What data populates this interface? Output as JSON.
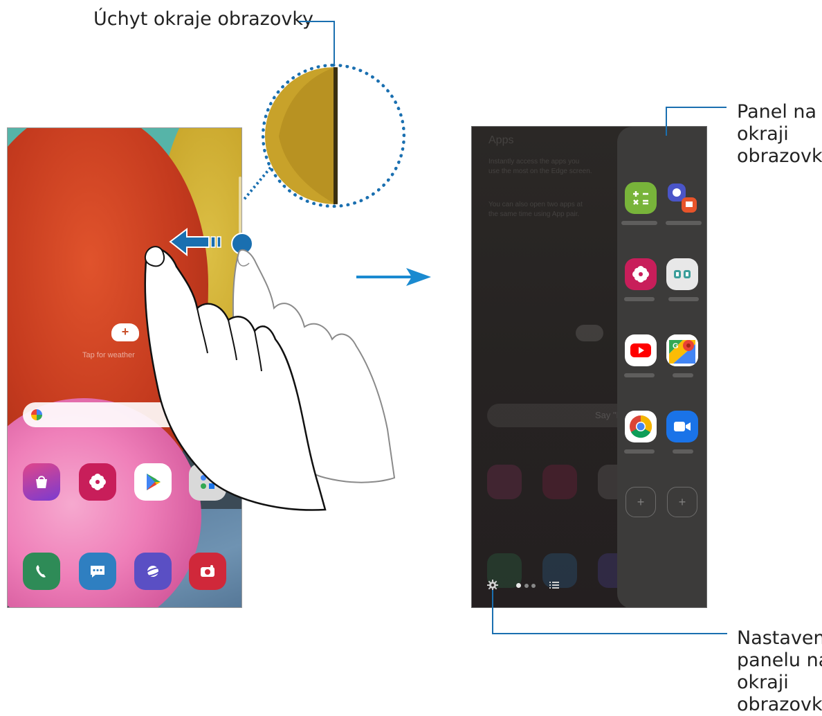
{
  "callouts": {
    "edge_handle": "Úchyt okraje obrazovky",
    "edge_panel_lines": [
      "Panel na",
      "okraji",
      "obrazovky"
    ],
    "edge_settings_lines": [
      "Nastavení",
      "panelu na",
      "okraji",
      "obrazovky"
    ]
  },
  "left_phone": {
    "weather_text": "Tap for weather",
    "dock_apps": [
      {
        "name": "Galaxy Store",
        "icon": "shopping-bag-icon",
        "color": "#c03a7a"
      },
      {
        "name": "Gallery",
        "icon": "flower-icon",
        "color": "#c81e5a"
      },
      {
        "name": "Play Store",
        "icon": "play-store-icon",
        "color": "#ffffff"
      },
      {
        "name": "Google",
        "icon": "folder-icon",
        "color": "#d9d9d9"
      }
    ],
    "bottom_apps": [
      {
        "name": "Phone",
        "icon": "phone-icon",
        "color": "#2e8b57"
      },
      {
        "name": "Messages",
        "icon": "message-icon",
        "color": "#2f7fc1"
      },
      {
        "name": "Internet",
        "icon": "planet-icon",
        "color": "#5a4fc4"
      },
      {
        "name": "Camera",
        "icon": "camera-icon",
        "color": "#d0283a"
      }
    ]
  },
  "right_phone": {
    "apps_title": "Apps",
    "apps_description": "Instantly access the apps you use the most on the Edge screen.",
    "apps_description_2": "You can also open two apps at the same time using App pair.",
    "search_text": "Say \"Hi",
    "edge_apps": [
      {
        "name": "Calculator",
        "icon": "calculator-icon",
        "color": "#78b43a"
      },
      {
        "name": "Internet Samsung Notes",
        "icon": "app-pair-icon",
        "color": "#4a55c8"
      },
      {
        "name": "Gallery",
        "icon": "flower-icon",
        "color": "#c81e5a"
      },
      {
        "name": "Folder",
        "icon": "folder-icon",
        "color": "#e8e8e8"
      },
      {
        "name": "YouTube",
        "icon": "youtube-icon",
        "color": "#ffffff"
      },
      {
        "name": "Maps",
        "icon": "maps-icon",
        "color": "#ffffff"
      },
      {
        "name": "Chrome",
        "icon": "chrome-icon",
        "color": "#ffffff"
      },
      {
        "name": "Duo",
        "icon": "video-icon",
        "color": "#1a73e8"
      }
    ]
  }
}
